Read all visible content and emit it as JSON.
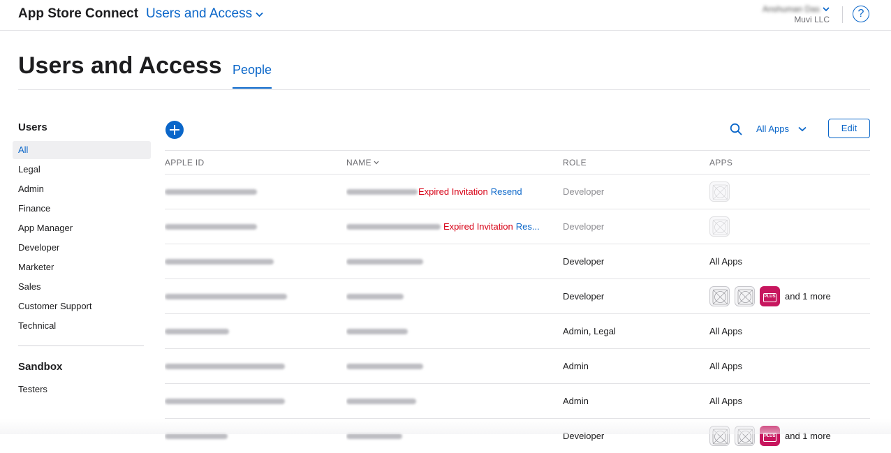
{
  "app": {
    "title": "App Store Connect"
  },
  "nav": {
    "section": "Users and Access"
  },
  "account": {
    "name": "Anshuman Das",
    "org": "Muvi LLC"
  },
  "help": {
    "label": "?"
  },
  "page": {
    "title": "Users and Access",
    "tab": "People"
  },
  "sidebar": {
    "users_heading": "Users",
    "items": [
      "All",
      "Legal",
      "Admin",
      "Finance",
      "App Manager",
      "Developer",
      "Marketer",
      "Sales",
      "Customer Support",
      "Technical"
    ],
    "active_index": 0,
    "sandbox_heading": "Sandbox",
    "sandbox_items": [
      "Testers"
    ]
  },
  "toolbar": {
    "apps_filter": "All Apps",
    "edit_label": "Edit"
  },
  "table": {
    "columns": {
      "apple_id": "APPLE ID",
      "name": "NAME",
      "role": "ROLE",
      "apps": "APPS"
    },
    "rows": [
      {
        "apple_id": "hissender@gmail.com",
        "name": "Hemant kumar",
        "status": "Expired Invitation",
        "action": "Resend",
        "role": "Developer",
        "apps": ""
      },
      {
        "apple_id": "sujatha.4@yahoo.com",
        "name": "Sujatha Padmanabhan",
        "status": "Expired Invitation",
        "action": "Res...",
        "role": "Developer",
        "apps": ""
      },
      {
        "apple_id": "qa-automation@muvi.com",
        "name": "Team QA Automation",
        "role": "Developer",
        "apps": "All Apps"
      },
      {
        "apple_id": "carlobellucci@yahoo.com",
        "name": "Carlo Bellucci",
        "role": "Developer",
        "apps": "and 1 more"
      },
      {
        "apple_id": "ios@muvi.com",
        "name": "Anshuman Das",
        "role": "Admin, Legal",
        "apps": "All Apps"
      },
      {
        "apple_id": "subramanyam.s@gmail.com",
        "name": "Anshuman Das",
        "role": "Admin",
        "apps": "All Apps"
      },
      {
        "apple_id": "kanha.debashish@gmail.com",
        "name": "Debashish Das",
        "role": "Admin",
        "apps": "All Apps"
      },
      {
        "apple_id": "d2c@muvi.com",
        "name": "D2C Dev Ops",
        "role": "Developer",
        "apps": "and 1 more"
      }
    ]
  },
  "icons": {
    "section_chevron": "chevron-down-icon",
    "help": "question-circle-icon",
    "add": "plus-circle-icon",
    "search": "search-icon",
    "filter_chevron": "chevron-down-icon",
    "placeholder_app": "app-placeholder-icon",
    "plus_app": "plus-app-icon"
  },
  "colors": {
    "accent": "#0a66c9",
    "expired": "#d70015",
    "plus_app": "#c7165e"
  }
}
